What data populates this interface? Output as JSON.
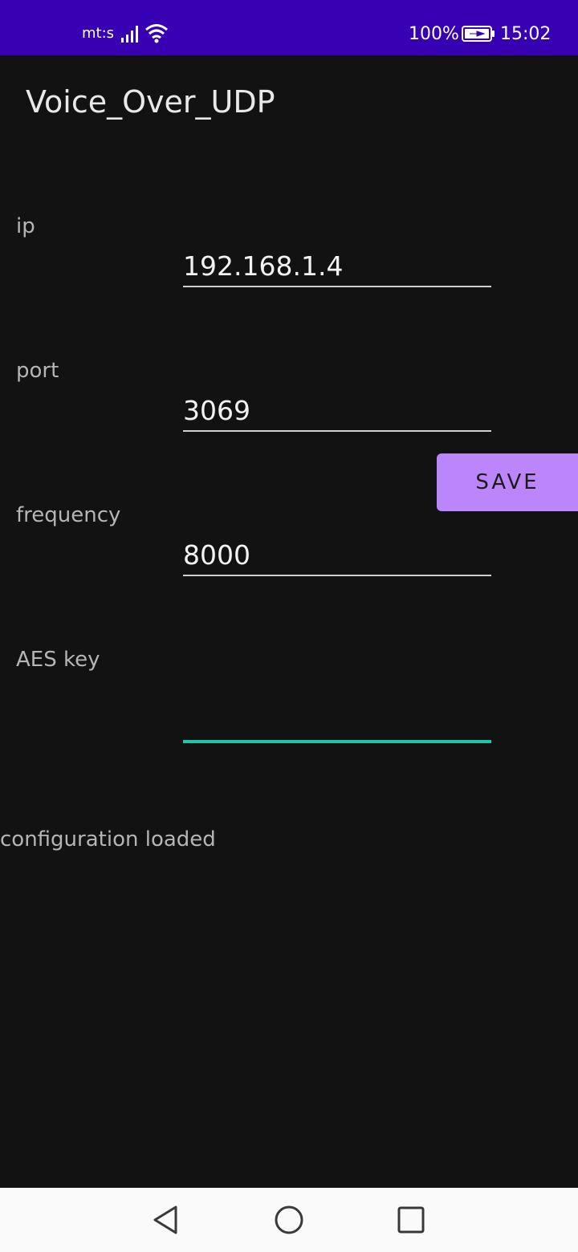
{
  "status_bar": {
    "carrier": "mt:s",
    "battery": "100%",
    "time": "15:02",
    "background_color": "#3700B3"
  },
  "app": {
    "title": "Voice_Over_UDP"
  },
  "fields": {
    "ip": {
      "label": "ip",
      "value": "192.168.1.4"
    },
    "port": {
      "label": "port",
      "value": "3069"
    },
    "frequency": {
      "label": "frequency",
      "value": "8000"
    },
    "aes_key": {
      "label": "AES key",
      "value": ""
    }
  },
  "save_button": {
    "label": "SAVE",
    "color": "#BB86FC"
  },
  "status_message": "configuration loaded",
  "colors": {
    "background": "#121212",
    "focus_underline": "#1fc7a8"
  },
  "nav_bar": {
    "icons": [
      "back-icon",
      "home-icon",
      "recents-icon"
    ]
  }
}
